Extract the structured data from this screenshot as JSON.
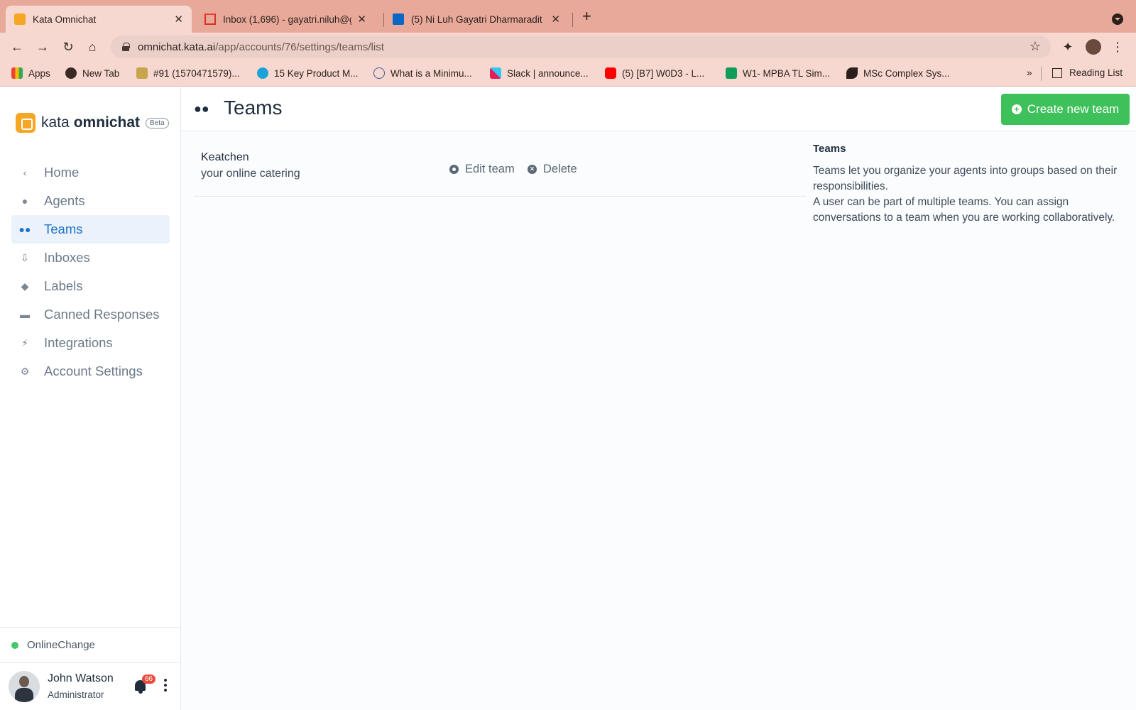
{
  "browser": {
    "tabs": [
      {
        "title": "Kata Omnichat",
        "active": true
      },
      {
        "title": "Inbox (1,696) - gayatri.niluh@g",
        "active": false
      },
      {
        "title": "(5) Ni Luh Gayatri Dharmaradit",
        "active": false
      }
    ],
    "url_host": "omnichat.kata.ai",
    "url_path": "/app/accounts/76/settings/teams/list",
    "bookmarks": [
      "Apps",
      "New Tab",
      "#91 (1570471579)...",
      "15 Key Product M...",
      "What is a Minimu...",
      "Slack | announce...",
      "(5) [B7] W0D3 - L...",
      "W1- MPBA TL Sim...",
      "MSc Complex Sys..."
    ],
    "bookmarks_overflow": "»",
    "reading_list": "Reading List"
  },
  "brand": {
    "kata": "kata",
    "omnichat": "omnichat",
    "beta": "Beta"
  },
  "sidebar": {
    "items": [
      {
        "label": "Home",
        "icon": "chevron-left-icon"
      },
      {
        "label": "Agents",
        "icon": "agents-icon"
      },
      {
        "label": "Teams",
        "icon": "teams-icon",
        "active": true
      },
      {
        "label": "Inboxes",
        "icon": "inbox-icon"
      },
      {
        "label": "Labels",
        "icon": "tag-icon"
      },
      {
        "label": "Canned Responses",
        "icon": "chat-bubble-icon"
      },
      {
        "label": "Integrations",
        "icon": "bolt-icon"
      },
      {
        "label": "Account Settings",
        "icon": "gear-icon"
      }
    ],
    "status": {
      "text": "Online",
      "change": "Change"
    },
    "user": {
      "name": "John Watson",
      "role": "Administrator",
      "notifications": "66"
    }
  },
  "page": {
    "title": "Teams",
    "create_button": "Create new team",
    "teams": [
      {
        "name": "Keatchen",
        "description": "your online catering",
        "edit": "Edit team",
        "delete": "Delete"
      }
    ],
    "info": {
      "title": "Teams",
      "p1": "Teams let you organize your agents into groups based on their responsibilities.",
      "p2": "A user can be part of multiple teams. You can assign conversations to a team when you are working collaboratively."
    }
  },
  "colors": {
    "accent": "#1f73c9",
    "success": "#3ec05a",
    "brand": "#f5a623",
    "badge": "#e94b3c"
  }
}
